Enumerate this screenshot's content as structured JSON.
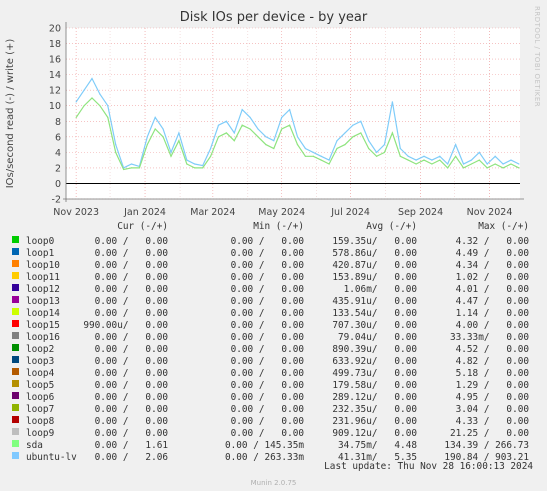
{
  "chart_data": {
    "type": "line",
    "title": "Disk IOs per device - by year",
    "ylabel": "IOs/second read (-) / write (+)",
    "ylim": [
      -2,
      20
    ],
    "yticks": [
      -2,
      0,
      2,
      4,
      6,
      8,
      10,
      12,
      14,
      16,
      18,
      20
    ],
    "xticks": [
      "Nov 2023",
      "Jan 2024",
      "Mar 2024",
      "May 2024",
      "Jul 2024",
      "Sep 2024",
      "Nov 2024"
    ],
    "grid": true,
    "series": [
      {
        "name": "ubuntu-lv",
        "color": "#7fccf9",
        "x": [
          "2023-11-01",
          "2023-11-08",
          "2023-11-15",
          "2023-11-22",
          "2023-11-29",
          "2023-12-06",
          "2023-12-13",
          "2023-12-20",
          "2023-12-27",
          "2024-01-03",
          "2024-01-10",
          "2024-01-17",
          "2024-01-24",
          "2024-01-31",
          "2024-02-07",
          "2024-02-14",
          "2024-02-21",
          "2024-02-28",
          "2024-03-06",
          "2024-03-13",
          "2024-03-20",
          "2024-03-27",
          "2024-04-03",
          "2024-04-10",
          "2024-04-17",
          "2024-04-24",
          "2024-05-01",
          "2024-05-08",
          "2024-05-15",
          "2024-05-22",
          "2024-05-29",
          "2024-06-05",
          "2024-06-12",
          "2024-06-19",
          "2024-06-26",
          "2024-07-03",
          "2024-07-10",
          "2024-07-17",
          "2024-07-24",
          "2024-07-31",
          "2024-08-07",
          "2024-08-14",
          "2024-08-21",
          "2024-08-28",
          "2024-09-04",
          "2024-09-11",
          "2024-09-18",
          "2024-09-25",
          "2024-10-02",
          "2024-10-09",
          "2024-10-16",
          "2024-10-23",
          "2024-10-30",
          "2024-11-06",
          "2024-11-13",
          "2024-11-20",
          "2024-11-27"
        ],
        "values": [
          10.5,
          12.0,
          13.5,
          11.5,
          10.0,
          5.0,
          2.0,
          2.5,
          2.2,
          6.0,
          8.5,
          7.0,
          4.0,
          6.5,
          3.0,
          2.5,
          2.3,
          4.5,
          7.5,
          8.0,
          6.5,
          9.5,
          8.5,
          7.0,
          6.0,
          5.5,
          8.5,
          9.5,
          6.0,
          4.5,
          4.0,
          3.5,
          3.0,
          5.5,
          6.5,
          7.5,
          8.0,
          5.5,
          4.0,
          5.0,
          10.5,
          4.5,
          3.5,
          3.0,
          3.5,
          3.0,
          3.5,
          2.5,
          5.0,
          2.5,
          3.0,
          4.0,
          2.5,
          3.5,
          2.5,
          3.0,
          2.5
        ]
      },
      {
        "name": "sda",
        "color": "#8fe47f",
        "x": [
          "2023-11-01",
          "2023-11-08",
          "2023-11-15",
          "2023-11-22",
          "2023-11-29",
          "2023-12-06",
          "2023-12-13",
          "2023-12-20",
          "2023-12-27",
          "2024-01-03",
          "2024-01-10",
          "2024-01-17",
          "2024-01-24",
          "2024-01-31",
          "2024-02-07",
          "2024-02-14",
          "2024-02-21",
          "2024-02-28",
          "2024-03-06",
          "2024-03-13",
          "2024-03-20",
          "2024-03-27",
          "2024-04-03",
          "2024-04-10",
          "2024-04-17",
          "2024-04-24",
          "2024-05-01",
          "2024-05-08",
          "2024-05-15",
          "2024-05-22",
          "2024-05-29",
          "2024-06-05",
          "2024-06-12",
          "2024-06-19",
          "2024-06-26",
          "2024-07-03",
          "2024-07-10",
          "2024-07-17",
          "2024-07-24",
          "2024-07-31",
          "2024-08-07",
          "2024-08-14",
          "2024-08-21",
          "2024-08-28",
          "2024-09-04",
          "2024-09-11",
          "2024-09-18",
          "2024-09-25",
          "2024-10-02",
          "2024-10-09",
          "2024-10-16",
          "2024-10-23",
          "2024-10-30",
          "2024-11-06",
          "2024-11-13",
          "2024-11-20",
          "2024-11-27"
        ],
        "values": [
          8.5,
          10.0,
          11.0,
          10.0,
          8.5,
          4.0,
          1.8,
          2.0,
          2.0,
          5.0,
          7.0,
          6.0,
          3.5,
          5.5,
          2.5,
          2.0,
          2.0,
          3.5,
          6.0,
          6.5,
          5.5,
          7.5,
          7.0,
          6.0,
          5.0,
          4.5,
          7.0,
          7.5,
          5.0,
          3.5,
          3.5,
          3.0,
          2.5,
          4.5,
          5.0,
          6.0,
          6.5,
          4.5,
          3.5,
          4.0,
          6.5,
          3.5,
          3.0,
          2.5,
          3.0,
          2.5,
          3.0,
          2.0,
          3.5,
          2.0,
          2.5,
          3.0,
          2.0,
          2.5,
          2.0,
          2.5,
          2.0
        ]
      }
    ]
  },
  "legend": {
    "header": {
      "cur": "Cur (-/+)",
      "min": "Min (-/+)",
      "avg": "Avg (-/+)",
      "max": "Max (-/+)"
    },
    "rows": [
      {
        "name": "loop0",
        "color": "#00cc00",
        "cur": "0.00 /   0.00",
        "min": "0.00 /   0.00",
        "avg": "159.35u/   0.00",
        "max": "4.32 /   0.00"
      },
      {
        "name": "loop1",
        "color": "#0066b3",
        "cur": "0.00 /   0.00",
        "min": "0.00 /   0.00",
        "avg": "578.86u/   0.00",
        "max": "4.49 /   0.00"
      },
      {
        "name": "loop10",
        "color": "#ff8000",
        "cur": "0.00 /   0.00",
        "min": "0.00 /   0.00",
        "avg": "420.87u/   0.00",
        "max": "4.34 /   0.00"
      },
      {
        "name": "loop11",
        "color": "#ffcc00",
        "cur": "0.00 /   0.00",
        "min": "0.00 /   0.00",
        "avg": "153.89u/   0.00",
        "max": "1.02 /   0.00"
      },
      {
        "name": "loop12",
        "color": "#330099",
        "cur": "0.00 /   0.00",
        "min": "0.00 /   0.00",
        "avg": "1.06m/   0.00",
        "max": "4.01 /   0.00"
      },
      {
        "name": "loop13",
        "color": "#990099",
        "cur": "0.00 /   0.00",
        "min": "0.00 /   0.00",
        "avg": "435.91u/   0.00",
        "max": "4.47 /   0.00"
      },
      {
        "name": "loop14",
        "color": "#ccff00",
        "cur": "0.00 /   0.00",
        "min": "0.00 /   0.00",
        "avg": "133.54u/   0.00",
        "max": "1.14 /   0.00"
      },
      {
        "name": "loop15",
        "color": "#ff0000",
        "cur": "990.00u/   0.00",
        "min": "0.00 /   0.00",
        "avg": "707.30u/   0.00",
        "max": "4.00 /   0.00"
      },
      {
        "name": "loop16",
        "color": "#808080",
        "cur": "0.00 /   0.00",
        "min": "0.00 /   0.00",
        "avg": "79.04u/   0.00",
        "max": "33.33m/   0.00"
      },
      {
        "name": "loop2",
        "color": "#008f00",
        "cur": "0.00 /   0.00",
        "min": "0.00 /   0.00",
        "avg": "890.39u/   0.00",
        "max": "4.52 /   0.00"
      },
      {
        "name": "loop3",
        "color": "#00487d",
        "cur": "0.00 /   0.00",
        "min": "0.00 /   0.00",
        "avg": "633.92u/   0.00",
        "max": "4.82 /   0.00"
      },
      {
        "name": "loop4",
        "color": "#b35a00",
        "cur": "0.00 /   0.00",
        "min": "0.00 /   0.00",
        "avg": "499.73u/   0.00",
        "max": "5.18 /   0.00"
      },
      {
        "name": "loop5",
        "color": "#b38f00",
        "cur": "0.00 /   0.00",
        "min": "0.00 /   0.00",
        "avg": "179.58u/   0.00",
        "max": "1.29 /   0.00"
      },
      {
        "name": "loop6",
        "color": "#6b006b",
        "cur": "0.00 /   0.00",
        "min": "0.00 /   0.00",
        "avg": "289.12u/   0.00",
        "max": "4.95 /   0.00"
      },
      {
        "name": "loop7",
        "color": "#8fb300",
        "cur": "0.00 /   0.00",
        "min": "0.00 /   0.00",
        "avg": "232.35u/   0.00",
        "max": "3.04 /   0.00"
      },
      {
        "name": "loop8",
        "color": "#b30000",
        "cur": "0.00 /   0.00",
        "min": "0.00 /   0.00",
        "avg": "231.96u/   0.00",
        "max": "4.33 /   0.00"
      },
      {
        "name": "loop9",
        "color": "#bebebe",
        "cur": "0.00 /   0.00",
        "min": "0.00 /   0.00",
        "avg": "909.12u/   0.00",
        "max": "21.25 /   0.00"
      },
      {
        "name": "sda",
        "color": "#80ff80",
        "cur": "0.00 /   1.61",
        "min": "0.00 / 145.35m",
        "avg": "34.75m/   4.48",
        "max": "134.39 / 266.73"
      },
      {
        "name": "ubuntu-lv",
        "color": "#80c9ff",
        "cur": "0.00 /   2.06",
        "min": "0.00 / 263.33m",
        "avg": "41.31m/   5.35",
        "max": "190.84 / 903.21"
      }
    ]
  },
  "last_update": "Last update: Thu Nov 28 16:00:13 2024",
  "side_label": "RRDTOOL / TOBI OETIKER",
  "footer": "Munin 2.0.75"
}
